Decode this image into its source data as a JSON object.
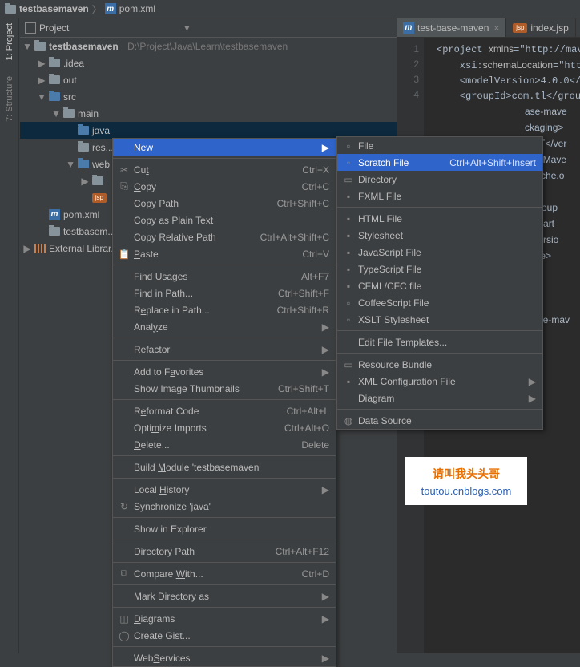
{
  "breadcrumb": {
    "root": "testbasemaven",
    "file": "pom.xml"
  },
  "toolwindow": {
    "title": "Project"
  },
  "sidebar": {
    "tabs": [
      "1: Project",
      "7: Structure"
    ]
  },
  "tree": {
    "root": "testbasemaven",
    "root_path": "D:\\Project\\Java\\Learn\\testbasemaven",
    "nodes": [
      {
        "label": ".idea"
      },
      {
        "label": "out"
      },
      {
        "label": "src"
      },
      {
        "label": "main"
      },
      {
        "label": "java"
      },
      {
        "label": "res..."
      },
      {
        "label": "web"
      },
      {
        "label": ""
      },
      {
        "label": "pom.xml"
      },
      {
        "label": "testbasem..."
      },
      {
        "label": "External Librar..."
      }
    ]
  },
  "tabs": [
    {
      "label": "test-base-maven",
      "type": "m"
    },
    {
      "label": "index.jsp",
      "type": "jsp"
    }
  ],
  "gutter": [
    1,
    2,
    3,
    4
  ],
  "code_lines": [
    "<project xmlns=\"http://maven",
    "    xsi:schemaLocation=\"http:/",
    "    <modelVersion>4.0.0</model",
    "    <groupId>com.tl</groupId"
  ],
  "code_tail": [
    "ase-mave",
    "ckaging>",
    "HOT</ver",
    "ven Mave",
    "apache.o",
    "",
    "</group",
    "nit</art",
    "</versio",
    "cope>",
    "",
    "",
    "",
    "/base-mav"
  ],
  "context_menu": [
    {
      "label": "New",
      "submenu": true,
      "highlight": true,
      "mn": 0
    },
    {
      "sep": true
    },
    {
      "label": "Cut",
      "shortcut": "Ctrl+X",
      "icon": "cut",
      "mn": 2
    },
    {
      "label": "Copy",
      "shortcut": "Ctrl+C",
      "icon": "copy",
      "mn": 0
    },
    {
      "label": "Copy Path",
      "shortcut": "Ctrl+Shift+C",
      "mn": 5
    },
    {
      "label": "Copy as Plain Text"
    },
    {
      "label": "Copy Relative Path",
      "shortcut": "Ctrl+Alt+Shift+C"
    },
    {
      "label": "Paste",
      "shortcut": "Ctrl+V",
      "icon": "paste",
      "mn": 0
    },
    {
      "sep": true
    },
    {
      "label": "Find Usages",
      "shortcut": "Alt+F7",
      "mn": 5
    },
    {
      "label": "Find in Path...",
      "shortcut": "Ctrl+Shift+F"
    },
    {
      "label": "Replace in Path...",
      "shortcut": "Ctrl+Shift+R",
      "mn": 1
    },
    {
      "label": "Analyze",
      "submenu": true,
      "mn": 4
    },
    {
      "sep": true
    },
    {
      "label": "Refactor",
      "submenu": true,
      "mn": 0
    },
    {
      "sep": true
    },
    {
      "label": "Add to Favorites",
      "submenu": true,
      "mn": 8
    },
    {
      "label": "Show Image Thumbnails",
      "shortcut": "Ctrl+Shift+T"
    },
    {
      "sep": true
    },
    {
      "label": "Reformat Code",
      "shortcut": "Ctrl+Alt+L",
      "mn": 1
    },
    {
      "label": "Optimize Imports",
      "shortcut": "Ctrl+Alt+O",
      "mn": 4
    },
    {
      "label": "Delete...",
      "shortcut": "Delete",
      "mn": 0
    },
    {
      "sep": true
    },
    {
      "label": "Build Module 'testbasemaven'",
      "mn": 6
    },
    {
      "sep": true
    },
    {
      "label": "Local History",
      "submenu": true,
      "mn": 6
    },
    {
      "label": "Synchronize 'java'",
      "icon": "sync",
      "mn": 1
    },
    {
      "sep": true
    },
    {
      "label": "Show in Explorer"
    },
    {
      "sep": true
    },
    {
      "label": "Directory Path",
      "shortcut": "Ctrl+Alt+F12",
      "mn": 10
    },
    {
      "sep": true
    },
    {
      "label": "Compare With...",
      "shortcut": "Ctrl+D",
      "icon": "diff",
      "mn": 8
    },
    {
      "sep": true
    },
    {
      "label": "Mark Directory as",
      "submenu": true
    },
    {
      "sep": true
    },
    {
      "label": "Diagrams",
      "submenu": true,
      "icon": "diag",
      "mn": 0
    },
    {
      "label": "Create Gist...",
      "icon": "gh"
    },
    {
      "sep": true
    },
    {
      "label": "WebServices",
      "submenu": true,
      "mn": 3
    }
  ],
  "submenu": [
    {
      "label": "File",
      "icon": "file"
    },
    {
      "label": "Scratch File",
      "shortcut": "Ctrl+Alt+Shift+Insert",
      "icon": "file",
      "highlight": true
    },
    {
      "label": "Directory",
      "icon": "folder"
    },
    {
      "label": "FXML File",
      "icon": "xml"
    },
    {
      "sep": true
    },
    {
      "label": "HTML File",
      "icon": "html"
    },
    {
      "label": "Stylesheet",
      "icon": "css"
    },
    {
      "label": "JavaScript File",
      "icon": "js"
    },
    {
      "label": "TypeScript File",
      "icon": "ts"
    },
    {
      "label": "CFML/CFC file",
      "icon": "cf"
    },
    {
      "label": "CoffeeScript File",
      "icon": "file"
    },
    {
      "label": "XSLT Stylesheet",
      "icon": "file"
    },
    {
      "sep": true
    },
    {
      "label": "Edit File Templates..."
    },
    {
      "sep": true
    },
    {
      "label": "Resource Bundle",
      "icon": "rb"
    },
    {
      "label": "XML Configuration File",
      "icon": "xml",
      "submenu": true
    },
    {
      "label": "Diagram",
      "submenu": true
    },
    {
      "sep": true
    },
    {
      "label": "Data Source",
      "icon": "db"
    }
  ],
  "watermark": {
    "line1": "请叫我头头哥",
    "line2": "toutou.cnblogs.com"
  }
}
